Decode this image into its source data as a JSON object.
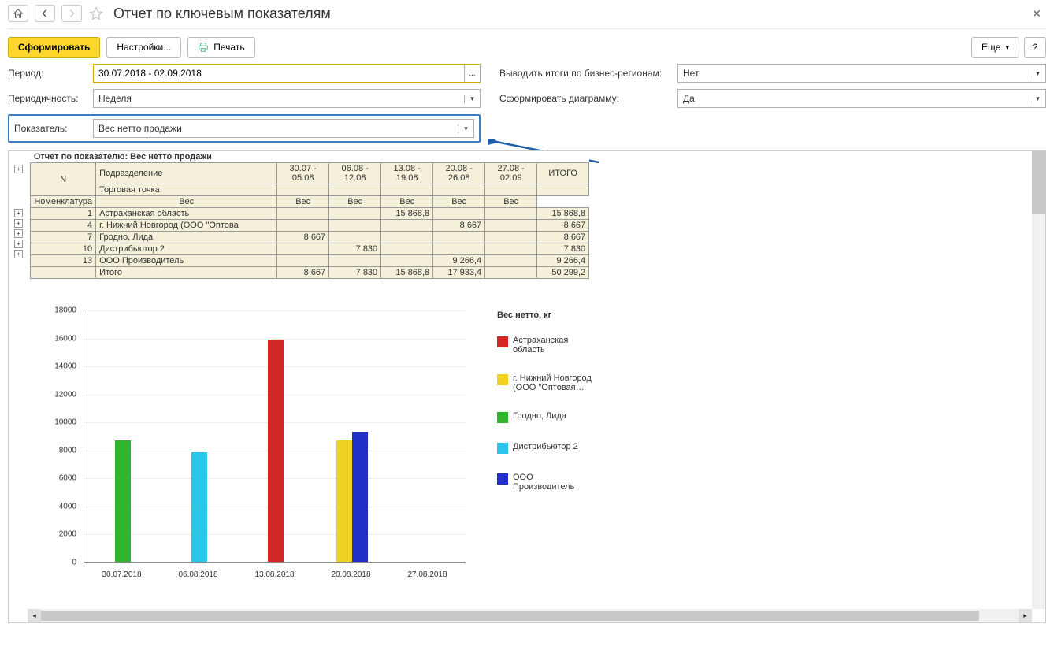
{
  "title": "Отчет по ключевым показателям",
  "toolbar": {
    "generate": "Сформировать",
    "settings": "Настройки...",
    "print": "Печать",
    "more": "Еще",
    "help": "?"
  },
  "filters": {
    "period_label": "Период:",
    "period_value": "30.07.2018 - 02.09.2018",
    "periodicity_label": "Периодичность:",
    "periodicity_value": "Неделя",
    "indicator_label": "Показатель:",
    "indicator_value": "Вес нетто продажи",
    "regions_label": "Выводить итоги по бизнес-регионам:",
    "regions_value": "Нет",
    "diagram_label": "Сформировать диаграмму:",
    "diagram_value": "Да"
  },
  "report": {
    "title": "Отчет по показателю: Вес нетто продажи",
    "header_rows": [
      "Подразделение",
      "Торговая точка",
      "Номенклатура"
    ],
    "n": "N",
    "periods": [
      "30.07 - 05.08",
      "06.08 - 12.08",
      "13.08 - 19.08",
      "20.08 - 26.08",
      "27.08 - 02.09"
    ],
    "total_col": "ИТОГО",
    "weight_label": "Вес",
    "total_row_label": "Итого",
    "rows": [
      {
        "n": "1",
        "label": "Астраханская область",
        "vals": [
          "",
          "",
          "15 868,8",
          "",
          ""
        ],
        "total": "15 868,8"
      },
      {
        "n": "4",
        "label": "г. Нижний Новгород (ООО \"Оптова",
        "vals": [
          "",
          "",
          "",
          "8 667",
          ""
        ],
        "total": "8 667"
      },
      {
        "n": "7",
        "label": "Гродно, Лида",
        "vals": [
          "8 667",
          "",
          "",
          "",
          ""
        ],
        "total": "8 667"
      },
      {
        "n": "10",
        "label": "Дистрибьютор 2",
        "vals": [
          "",
          "7 830",
          "",
          "",
          ""
        ],
        "total": "7 830"
      },
      {
        "n": "13",
        "label": "ООО Производитель",
        "vals": [
          "",
          "",
          "",
          "9 266,4",
          ""
        ],
        "total": "9 266,4"
      }
    ],
    "totals": [
      "8 667",
      "7 830",
      "15 868,8",
      "17 933,4",
      ""
    ],
    "grand_total": "50 299,2"
  },
  "chart_data": {
    "type": "bar",
    "title": "Вес нетто, кг",
    "ylim": [
      0,
      18000
    ],
    "yticks": [
      0,
      2000,
      4000,
      6000,
      8000,
      10000,
      12000,
      14000,
      16000,
      18000
    ],
    "categories": [
      "30.07.2018",
      "06.08.2018",
      "13.08.2018",
      "20.08.2018",
      "27.08.2018"
    ],
    "series": [
      {
        "name": "Астраханская область",
        "color": "#d32626",
        "values": [
          null,
          null,
          15868.8,
          null,
          null
        ]
      },
      {
        "name": "г. Нижний Новгород (ООО \"Оптовая…",
        "color": "#f0d222",
        "values": [
          null,
          null,
          null,
          8667,
          null
        ]
      },
      {
        "name": "Гродно, Лида",
        "color": "#2fb52b",
        "values": [
          8667,
          null,
          null,
          null,
          null
        ]
      },
      {
        "name": "Дистрибьютор 2",
        "color": "#2bc5ea",
        "values": [
          null,
          7830,
          null,
          null,
          null
        ]
      },
      {
        "name": "ООО Производитель",
        "color": "#2131c8",
        "values": [
          null,
          null,
          null,
          9266.4,
          null
        ]
      }
    ]
  }
}
